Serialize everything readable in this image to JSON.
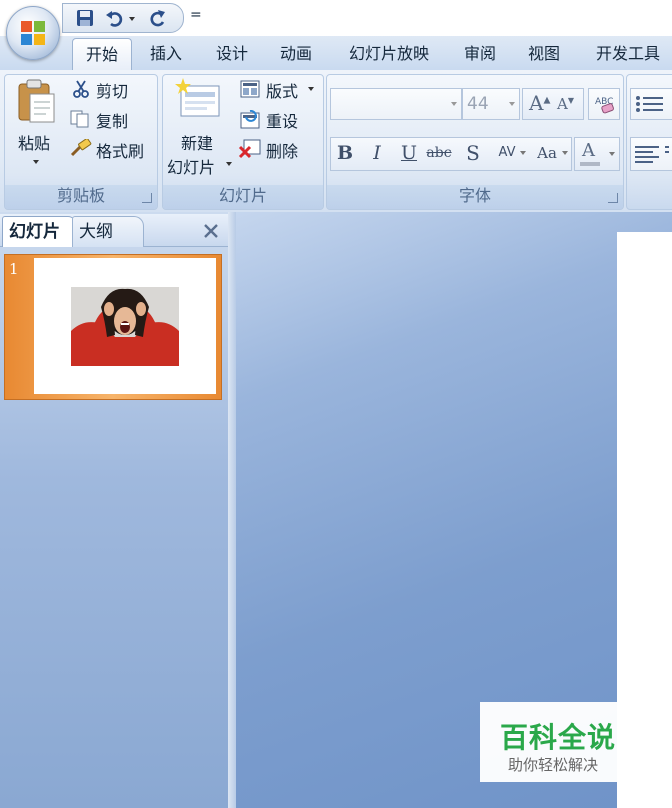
{
  "window": {
    "quick_access_more": "="
  },
  "tabs": [
    {
      "label": "开始",
      "active": true
    },
    {
      "label": "插入"
    },
    {
      "label": "设计"
    },
    {
      "label": "动画"
    },
    {
      "label": "幻灯片放映"
    },
    {
      "label": "审阅"
    },
    {
      "label": "视图"
    },
    {
      "label": "开发工具"
    }
  ],
  "clipboard": {
    "paste": "粘贴",
    "cut": "剪切",
    "copy": "复制",
    "format_painter": "格式刷",
    "group_label": "剪贴板"
  },
  "slides_group": {
    "new_slide_line1": "新建",
    "new_slide_line2": "幻灯片",
    "layout": "版式",
    "reset": "重设",
    "delete": "删除",
    "group_label": "幻灯片"
  },
  "font": {
    "font_name": "",
    "font_size": "44",
    "bold": "B",
    "italic": "I",
    "underline": "U",
    "strike": "abc",
    "shadow": "S",
    "spacing": "AV",
    "case": "Aa",
    "color": "A",
    "group_label": "字体"
  },
  "pane": {
    "tab_slides": "幻灯片",
    "tab_outline": "大纲",
    "slide_number": "1"
  },
  "watermark": {
    "title": "百科全说",
    "subtitle": "助你轻松解决"
  },
  "colors": {
    "accent_orange": "#e88932",
    "ribbon_blue": "#dde7f4",
    "canvas_blue": "#7d9ece",
    "watermark_green": "#2aa84a"
  }
}
